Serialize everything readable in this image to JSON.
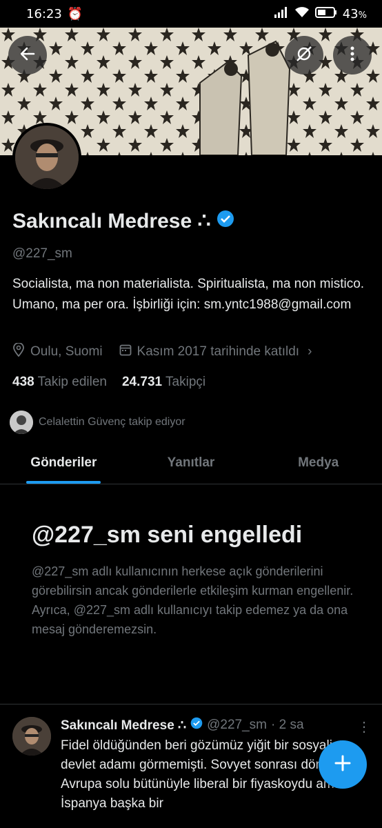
{
  "status_bar": {
    "time": "16:23",
    "battery": "43"
  },
  "profile": {
    "name": "Sakıncalı Medrese ∴",
    "handle": "@227_sm",
    "bio": "Socialista, ma non materialista. Spiritualista, ma non mistico. Umano, ma per ora.  İşbirliği için: sm.yntc1988@gmail.com",
    "location": "Oulu, Suomi",
    "joined": "Kasım 2017 tarihinde katıldı",
    "following_count": "438",
    "following_label": "Takip edilen",
    "followers_count": "24.731",
    "followers_label": "Takipçi",
    "followed_by": "Celalettin Güvenç takip ediyor"
  },
  "tabs": [
    {
      "label": "Gönderiler",
      "active": true
    },
    {
      "label": "Yanıtlar",
      "active": false
    },
    {
      "label": "Medya",
      "active": false
    }
  ],
  "blocked": {
    "title": "@227_sm seni engelledi",
    "description": "@227_sm adlı kullanıcının herkese açık gönderilerini görebilirsin ancak gönderilerle etkileşim kurman engellenir. Ayrıca, @227_sm adlı kullanıcıyı takip edemez ya da ona mesaj gönderemezsin."
  },
  "tweet": {
    "name": "Sakıncalı Medrese ∴",
    "handle": "@227_sm",
    "time": "· 2 sa",
    "text": "Fidel öldüğünden beri gözümüz yiğit bir sosyalist devlet adamı görmemişti. Sovyet sonrası dönemde Avrupa solu bütünüyle liberal bir fiyaskoydu ama İspanya başka bir"
  },
  "colors": {
    "accent": "#1d9bf0",
    "background": "#000000",
    "muted": "#71767b"
  },
  "icons": [
    "back-arrow-icon",
    "no-notification-icon",
    "more-vertical-icon",
    "verified-badge-icon",
    "location-icon",
    "calendar-icon",
    "chevron-right-icon",
    "plus-icon"
  ]
}
